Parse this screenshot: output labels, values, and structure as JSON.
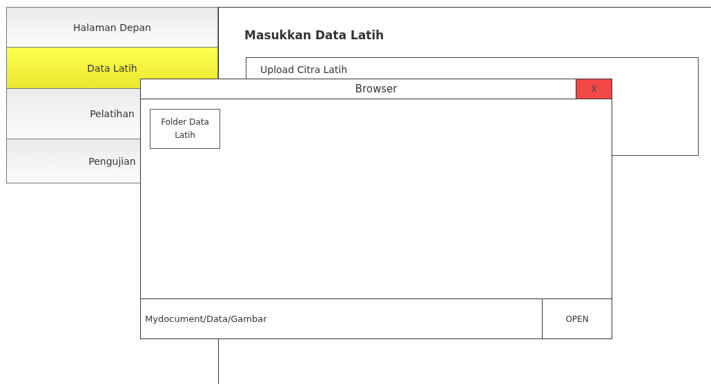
{
  "sidebar": {
    "items": [
      {
        "label": "Halaman Depan",
        "selected": false
      },
      {
        "label": "Data Latih",
        "selected": true
      },
      {
        "label": "Pelatihan",
        "selected": false
      },
      {
        "label": "Pengujian",
        "selected": false
      }
    ]
  },
  "main": {
    "heading": "Masukkan Data Latih",
    "upload_panel": {
      "label": "Upload Citra Latih"
    }
  },
  "dialog": {
    "title": "Browser",
    "close_label": "X",
    "folders": [
      {
        "label": "Folder Data Latih"
      }
    ],
    "path": "Mydocument/Data/Gambar",
    "open_label": "OPEN"
  }
}
